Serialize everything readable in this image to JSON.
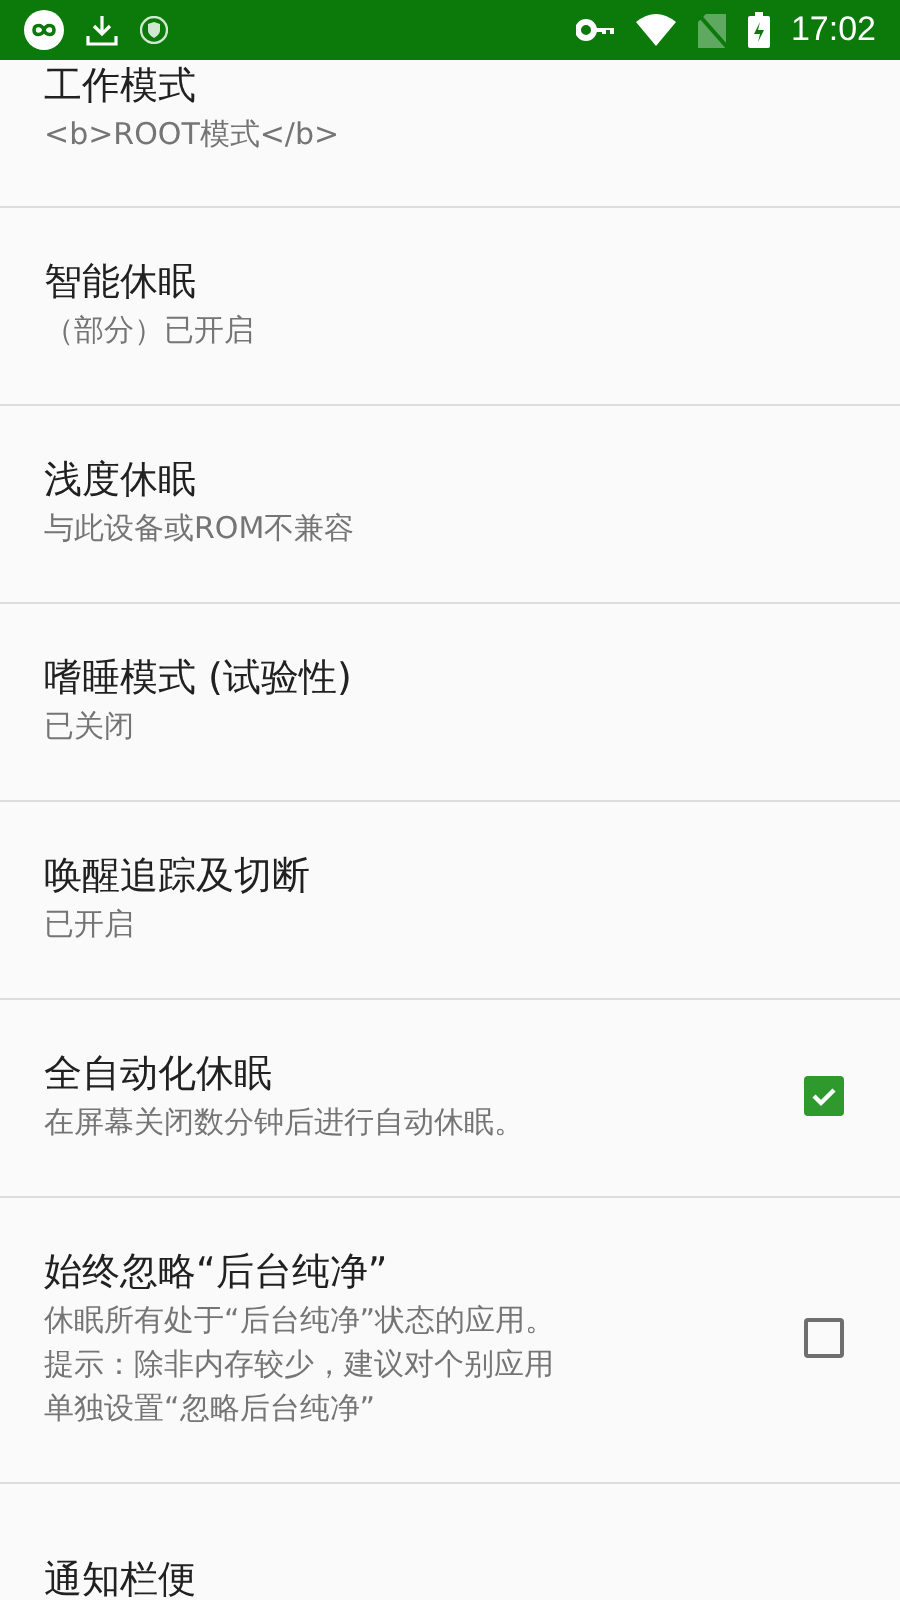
{
  "status_bar": {
    "time": "17:02"
  },
  "settings": [
    {
      "kind": "plain",
      "title": "工作模式",
      "summary": [
        "<b>ROOT模式</b>"
      ]
    },
    {
      "kind": "plain",
      "title": "智能休眠",
      "summary": [
        "（部分）已开启"
      ]
    },
    {
      "kind": "plain",
      "title": "浅度休眠",
      "summary": [
        "与此设备或ROM不兼容"
      ]
    },
    {
      "kind": "plain",
      "title": "嗜睡模式 (试验性)",
      "summary": [
        "已关闭"
      ]
    },
    {
      "kind": "plain",
      "title": "唤醒追踪及切断",
      "summary": [
        "已开启"
      ]
    },
    {
      "kind": "checkbox",
      "title": "全自动化休眠",
      "summary": [
        "在屏幕关闭数分钟后进行自动休眠。"
      ],
      "checked": true
    },
    {
      "kind": "checkbox",
      "title": "始终忽略“后台纯净”",
      "summary": [
        "休眠所有处于“后台纯净”状态的应用。",
        "提示：除非内存较少，建议对个别应用",
        "单独设置“忽略后台纯净”"
      ],
      "checked": false
    },
    {
      "kind": "plain",
      "title": "通知栏便"
    }
  ]
}
